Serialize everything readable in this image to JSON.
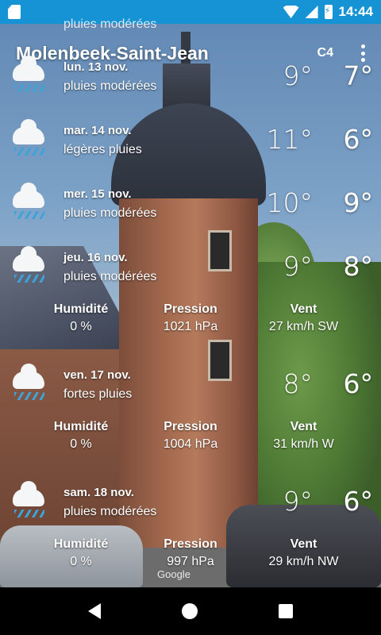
{
  "status_bar": {
    "time": "14:44"
  },
  "app_bar": {
    "city": "Molenbeek-Saint-Jean",
    "code": "C4"
  },
  "partial_row_text": "pluies modérées",
  "forecast": [
    {
      "day": "lun. 13 nov.",
      "condition": "pluies modérées",
      "max": "9°",
      "min": "7°"
    },
    {
      "day": "mar. 14 nov.",
      "condition": "légères pluies",
      "max": "11°",
      "min": "6°"
    },
    {
      "day": "mer. 15 nov.",
      "condition": "pluies modérées",
      "max": "10°",
      "min": "9°"
    },
    {
      "day": "jeu. 16 nov.",
      "condition": "pluies modérées",
      "max": "9°",
      "min": "8°"
    },
    {
      "day": "ven. 17 nov.",
      "condition": "fortes pluies",
      "max": "8°",
      "min": "6°"
    },
    {
      "day": "sam. 18 nov.",
      "condition": "pluies modérées",
      "max": "9°",
      "min": "6°"
    }
  ],
  "details_labels": {
    "humidity": "Humidité",
    "pressure": "Pression",
    "wind": "Vent"
  },
  "details": [
    {
      "humidity": "0 %",
      "pressure": "1021 hPa",
      "wind": "27 km/h SW"
    },
    {
      "humidity": "0 %",
      "pressure": "1004 hPa",
      "wind": "31 km/h W"
    },
    {
      "humidity": "0 %",
      "pressure": "997 hPa",
      "wind": "29 km/h NW"
    }
  ],
  "watermark": "Google",
  "icons": {
    "weather": "rain-cloud-icon",
    "more": "more-vert-icon",
    "nav_back": "back-icon",
    "nav_home": "home-icon",
    "nav_recents": "recents-icon"
  },
  "colors": {
    "status_bar": "#1693d4",
    "rain_drops": "#3fa2d8"
  }
}
